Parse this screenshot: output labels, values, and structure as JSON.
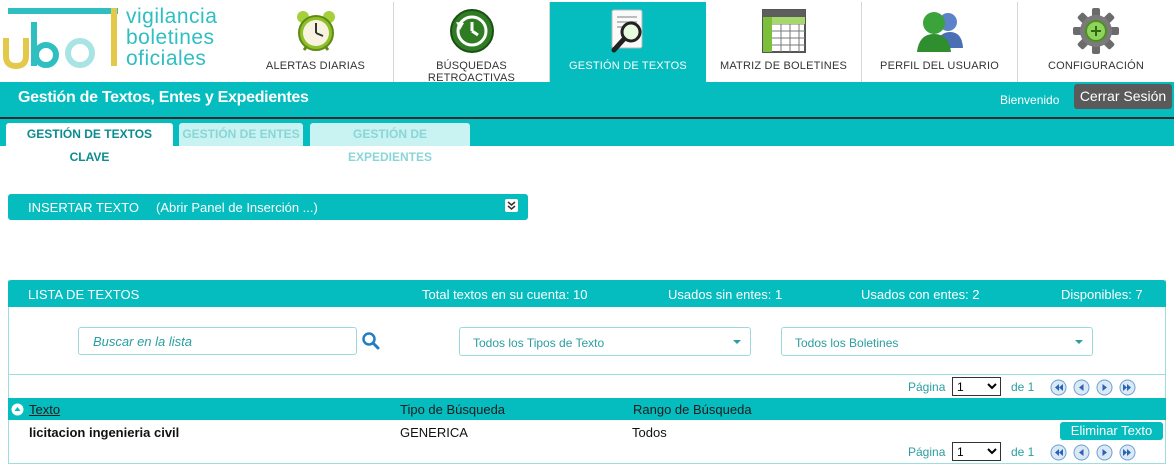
{
  "logo": {
    "letters": "ubo",
    "words": [
      "vigilancia",
      "boletines",
      "oficiales"
    ]
  },
  "nav": [
    {
      "label": "ALERTAS DIARIAS",
      "icon": "alarm-clock-icon",
      "active": false
    },
    {
      "label": "BÚSQUEDAS RETROACTIVAS",
      "icon": "history-clock-icon",
      "active": false
    },
    {
      "label": "GESTIÓN DE TEXTOS",
      "icon": "document-magnifier-icon",
      "active": true
    },
    {
      "label": "MATRIZ DE BOLETINES",
      "icon": "spreadsheet-icon",
      "active": false
    },
    {
      "label": "PERFIL DEL USUARIO",
      "icon": "user-profile-icon",
      "active": false
    },
    {
      "label": "CONFIGURACIÓN",
      "icon": "gear-icon",
      "active": false
    }
  ],
  "header": {
    "title": "Gestión de Textos, Entes y Expedientes",
    "welcome": "Bienvenido",
    "logout_label": "Cerrar Sesión"
  },
  "subtabs": [
    {
      "label": "GESTIÓN DE TEXTOS CLAVE",
      "active": true
    },
    {
      "label": "GESTIÓN DE ENTES",
      "active": false
    },
    {
      "label": "GESTIÓN DE EXPEDIENTES",
      "active": false
    }
  ],
  "insert_panel": {
    "title": "INSERTAR TEXTO",
    "hint": "(Abrir Panel de Inserción ...)"
  },
  "list": {
    "title": "LISTA DE TEXTOS",
    "total": "Total textos en su cuenta: 10",
    "without_entities": "Usados sin entes: 1",
    "with_entities": "Usados con entes: 2",
    "available": "Disponibles: 7",
    "search_placeholder": "Buscar en la lista",
    "type_filter": "Todos los Tipos de Texto",
    "bulletin_filter": "Todos los Boletines",
    "pager": {
      "label": "Página",
      "current": "1",
      "of_label": "de 1"
    },
    "columns": [
      "Texto",
      "Tipo de Búsqueda",
      "Rango de Búsqueda"
    ],
    "rows": [
      {
        "texto": "licitacion ingenieria civil",
        "tipo": "GENERICA",
        "rango": "Todos",
        "action": "Eliminar Texto"
      }
    ]
  },
  "colors": {
    "accent": "#05bcbf",
    "accent_light": "#c9f2f2",
    "logout_bg": "#5a5a5a",
    "logo_yellow": "#e3c84a",
    "logo_teal": "#2fbfc1"
  }
}
